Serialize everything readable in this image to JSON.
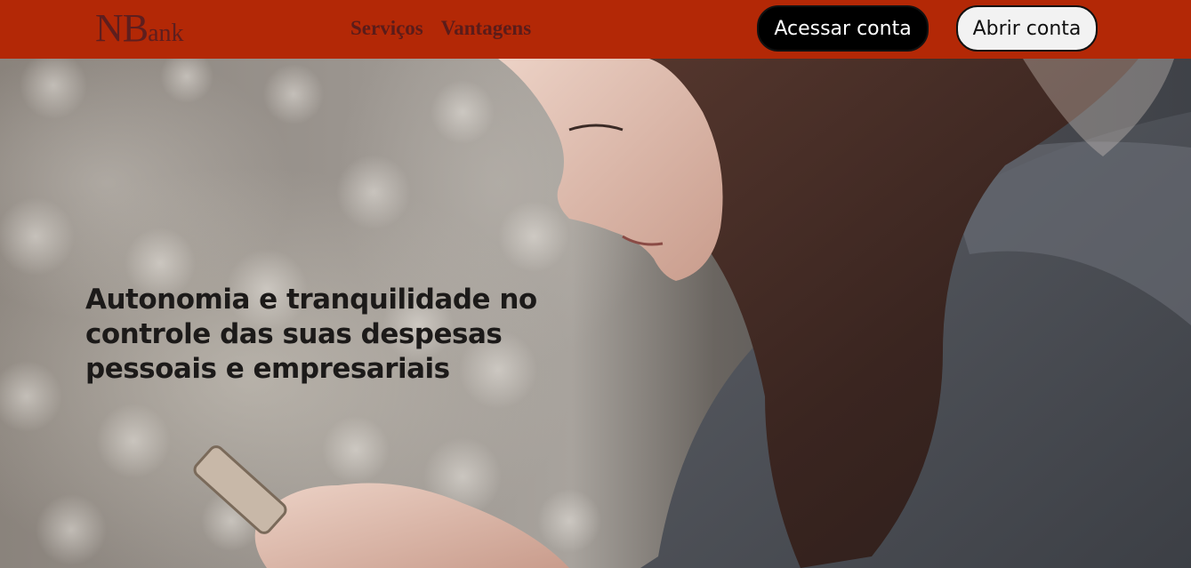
{
  "header": {
    "logo": {
      "initials": "NB",
      "rest": "ank"
    },
    "nav": [
      {
        "label": "Serviços"
      },
      {
        "label": "Vantagens"
      }
    ],
    "login_button": "Acessar conta",
    "signup_button": "Abrir conta"
  },
  "hero": {
    "headline": "Autonomia e tranquilidade no controle das suas despesas pessoais e empresariais",
    "image_icon": "woman-using-phone-photo"
  },
  "colors": {
    "header_bg": "#b32806",
    "logo": "#5e1e1e",
    "login_bg": "#000000",
    "signup_bg": "#f2f2f2"
  }
}
